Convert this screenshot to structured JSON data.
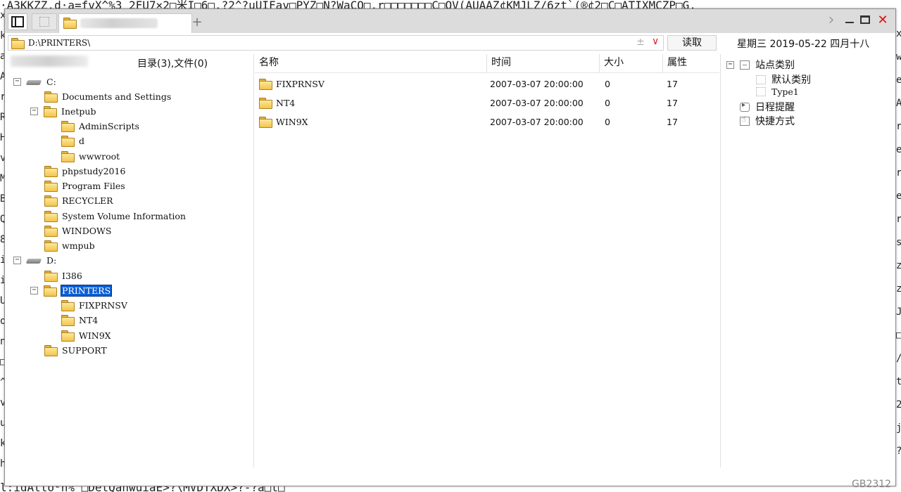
{
  "bg_noise": {
    "top": "·A3KKZZ.d·a=fvX^%3 2FU7×2□米I□6□.?2^?uUIFav□PYZ□N?WaCO□.r□□□□□□□C□OV(AUAAZ¢KMJLZ/6zt`(®¢2□C□ATIXMCZP□G.",
    "bottom": "l:idAtto²n%  □DetQanwuiaE>?\\MVDTXDX>?-?a□t□",
    "left_chars": [
      "x",
      "k",
      "a",
      "A",
      "r",
      "R",
      "H",
      "v",
      "M",
      "B",
      "Q",
      "8",
      "i",
      "i",
      "U",
      "o",
      "n",
      "□",
      "^",
      "v",
      "u",
      "k",
      "h"
    ],
    "right_chars": [
      "x",
      "w",
      "e",
      "A",
      "r",
      "e",
      "r",
      "e",
      "r",
      "s",
      "z",
      "z",
      "J",
      "□",
      "/",
      "t",
      "2",
      "j",
      "?"
    ]
  },
  "window": {
    "tab_title_blurred": "",
    "add_tab": "+",
    "next_btn": "›",
    "close_btn": "✕"
  },
  "toolbar": {
    "path": "D:\\PRINTERS\\",
    "plusminus": "±",
    "dropdown": "∨",
    "read_label": "读取",
    "date": "星期三 2019-05-22 四月十八"
  },
  "left": {
    "count": "目录(3),文件(0)"
  },
  "tree": {
    "c_drive": "C:",
    "c_items": [
      "Documents and Settings",
      "Inetpub",
      "AdminScripts",
      "d",
      "wwwroot",
      "phpstudy2016",
      "Program Files",
      "RECYCLER",
      "System Volume Information",
      "WINDOWS",
      "wmpub"
    ],
    "d_drive": "D:",
    "d_items": [
      "I386",
      "PRINTERS",
      "FIXPRNSV",
      "NT4",
      "WIN9X",
      "SUPPORT"
    ]
  },
  "list": {
    "headers": {
      "name": "名称",
      "time": "时间",
      "size": "大小",
      "attr": "属性"
    },
    "rows": [
      {
        "name": "FIXPRNSV",
        "time": "2007-03-07 20:00:00",
        "size": "0",
        "attr": "17"
      },
      {
        "name": "NT4",
        "time": "2007-03-07 20:00:00",
        "size": "0",
        "attr": "17"
      },
      {
        "name": "WIN9X",
        "time": "2007-03-07 20:00:00",
        "size": "0",
        "attr": "17"
      }
    ]
  },
  "right": {
    "site_category": "站点类别",
    "default_category": "默认类别",
    "type1": "Type1",
    "schedule": "日程提醒",
    "shortcut": "快捷方式"
  },
  "status": {
    "encoding": "GB2312"
  }
}
